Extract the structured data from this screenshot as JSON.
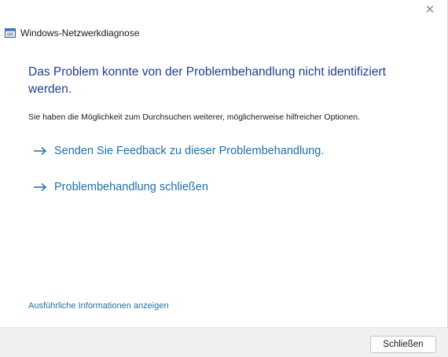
{
  "window": {
    "title": "Windows-Netzwerkdiagnose",
    "close_glyph": "✕",
    "app_icon": "network-diagnostics-icon"
  },
  "main": {
    "headline": "Das Problem konnte von der Problembehandlung nicht identifiziert werden.",
    "subtext": "Sie haben die Möglichkeit zum Durchsuchen weiterer, möglicherweise hilfreicher Optionen.",
    "options": [
      {
        "label": "Senden Sie Feedback zu dieser Problembehandlung.",
        "icon": "arrow-right-icon"
      },
      {
        "label": "Problembehandlung schließen",
        "icon": "arrow-right-icon"
      }
    ],
    "details_link": "Ausführliche Informationen anzeigen"
  },
  "footer": {
    "close_button": "Schließen"
  },
  "colors": {
    "headline": "#1d3f8f",
    "link": "#1f6fa8",
    "footer_bg": "#f0f0f0"
  }
}
